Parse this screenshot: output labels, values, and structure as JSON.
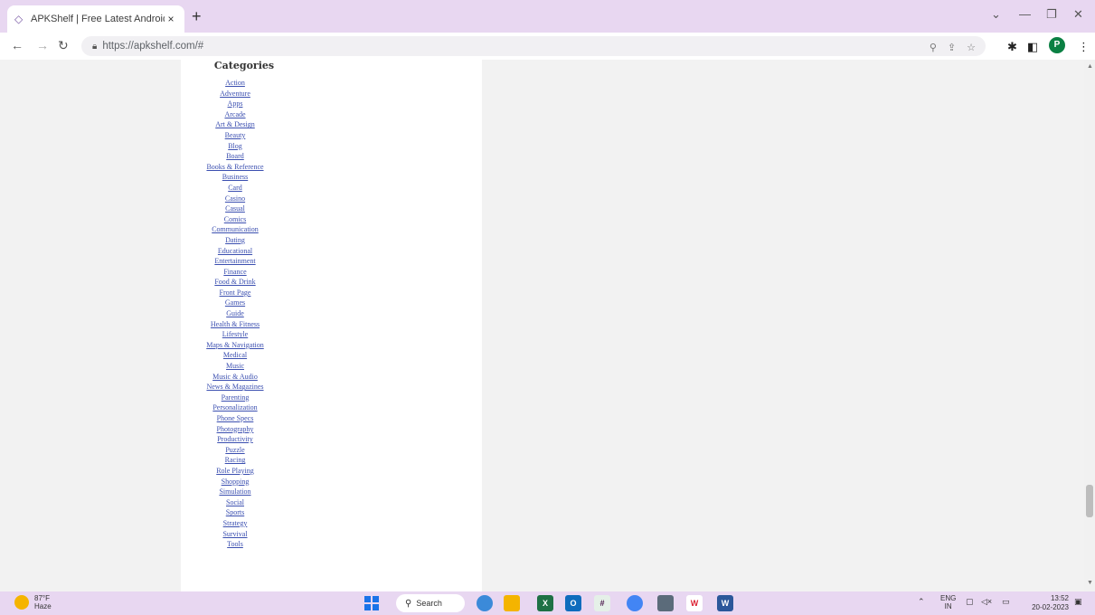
{
  "browser": {
    "tab_title": "APKShelf | Free Latest Android A",
    "tab_close": "×",
    "new_tab": "+",
    "url": "https://apkshelf.com/#",
    "profile_initial": "P"
  },
  "page": {
    "categories_title": "Categories",
    "categories": [
      "Action",
      "Adventure",
      "Apps",
      "Arcade",
      "Art & Design",
      "Beauty",
      "Blog",
      "Board",
      "Books & Reference",
      "Business",
      "Card",
      "Casino",
      "Casual",
      "Comics",
      "Communication",
      "Dating",
      "Educational",
      "Entertainment",
      "Finance",
      "Food & Drink",
      "Front Page",
      "Games",
      "Guide",
      "Health & Fitness",
      "Lifestyle",
      "Maps & Navigation",
      "Medical",
      "Music",
      "Music & Audio",
      "News & Magazines",
      "Parenting",
      "Personalization",
      "Phone Specs",
      "Photography",
      "Productivity",
      "Puzzle",
      "Racing",
      "Role Playing",
      "Shopping",
      "Simulation",
      "Social",
      "Sports",
      "Strategy",
      "Survival",
      "Tools"
    ]
  },
  "taskbar": {
    "weather_temp": "87°F",
    "weather_desc": "Haze",
    "search_label": "Search",
    "lang_top": "ENG",
    "lang_bottom": "IN",
    "time": "13:52",
    "date": "20-02-2023"
  }
}
